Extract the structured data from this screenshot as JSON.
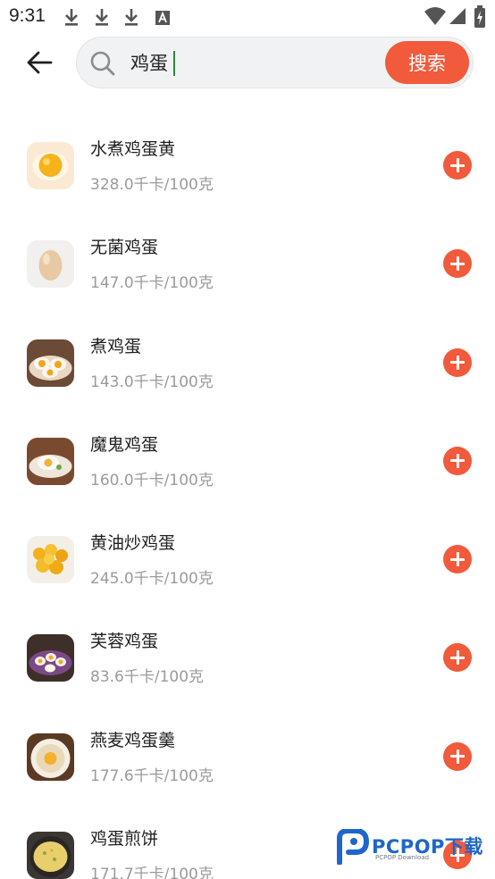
{
  "status_bar": {
    "time": "9:31",
    "left_icons": [
      "download-icon",
      "download-icon",
      "download-icon",
      "font-a-icon"
    ],
    "right_icons": [
      "wifi-icon",
      "cell-signal-icon",
      "battery-charging-icon"
    ]
  },
  "search": {
    "query": "鸡蛋",
    "button_label": "搜索"
  },
  "foods": [
    {
      "name": "水煮鸡蛋黄",
      "calories": "328.0千卡/100克",
      "image": "egg-yolk"
    },
    {
      "name": "无菌鸡蛋",
      "calories": "147.0千卡/100克",
      "image": "whole-egg"
    },
    {
      "name": "煮鸡蛋",
      "calories": "143.0千卡/100克",
      "image": "boiled-egg-halves"
    },
    {
      "name": "魔鬼鸡蛋",
      "calories": "160.0千卡/100克",
      "image": "deviled-eggs"
    },
    {
      "name": "黄油炒鸡蛋",
      "calories": "245.0千卡/100克",
      "image": "butter-scrambled-eggs"
    },
    {
      "name": "芙蓉鸡蛋",
      "calories": "83.6千卡/100克",
      "image": "egg-foo-young"
    },
    {
      "name": "燕麦鸡蛋羹",
      "calories": "177.6千卡/100克",
      "image": "oat-egg-custard"
    },
    {
      "name": "鸡蛋煎饼",
      "calories": "171.7千卡/100克",
      "image": "egg-pancake"
    }
  ],
  "watermark": {
    "brand": "PCPOP下载",
    "sub": "PCPOP Download"
  },
  "colors": {
    "accent": "#f15a3b",
    "text_primary": "#1f1f1f",
    "text_secondary": "#9a9a9a",
    "search_bg": "#f1f2f4",
    "watermark_blue": "#1e66c9"
  }
}
